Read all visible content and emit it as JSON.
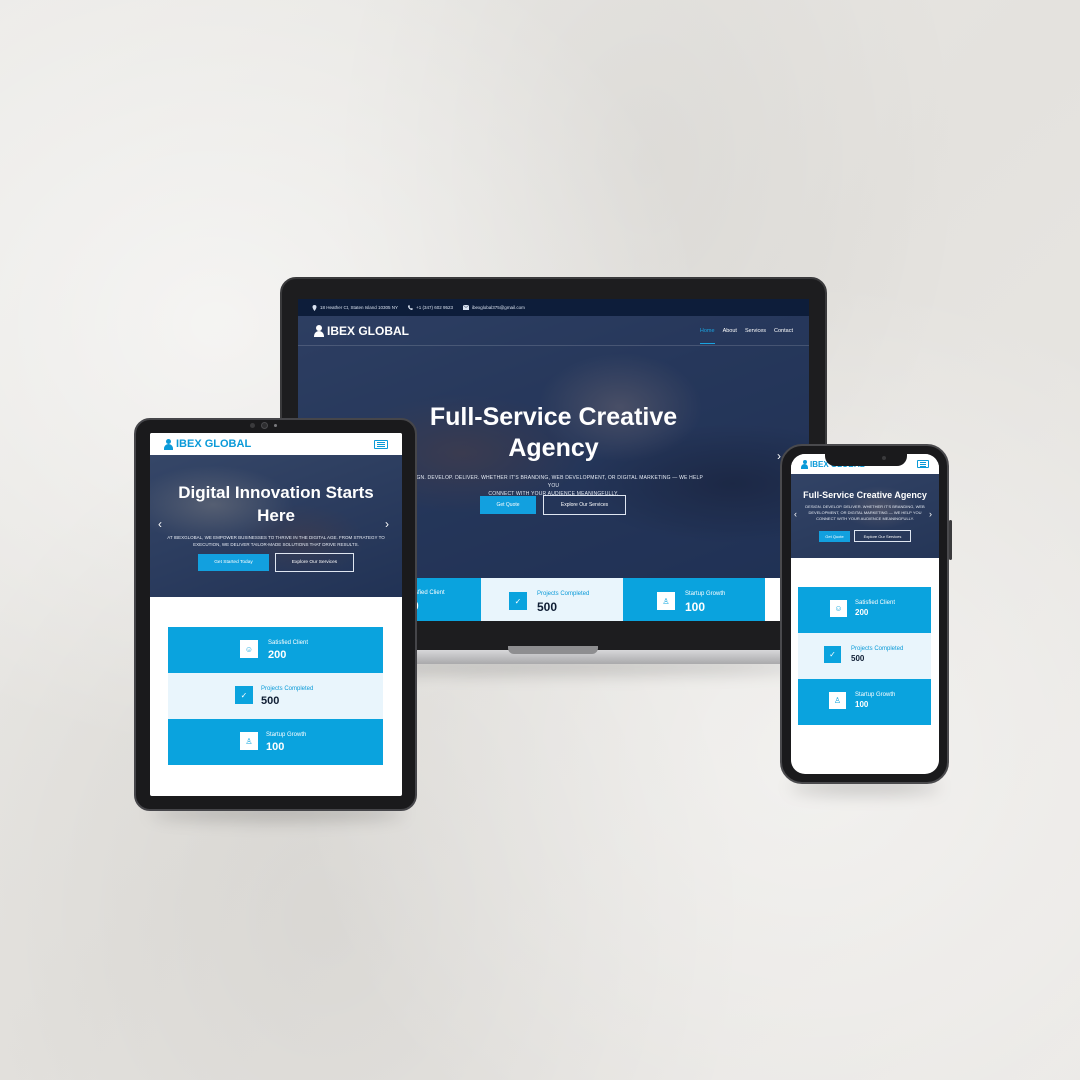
{
  "brand": {
    "name": "IBEX GLOBAL"
  },
  "desktop": {
    "topbar": {
      "address": "18 Heather Ct, Staten Island 10305 NY",
      "phone": "+1 (347) 602 9523",
      "email": "ibexglobal375@gmail.com"
    },
    "nav": {
      "items": [
        "Home",
        "About",
        "Services",
        "Contact"
      ],
      "active": "Home"
    },
    "hero": {
      "title_line1": "Full-Service Creative",
      "title_line2": "Agency",
      "subtitle_line1": "DESIGN. DEVELOP. DELIVER. WHETHER IT'S BRANDING, WEB DEVELOPMENT, OR DIGITAL MARKETING — WE HELP YOU",
      "subtitle_line2": "CONNECT WITH YOUR AUDIENCE MEANINGFULLY.",
      "primary_button": "Get Quote",
      "secondary_button": "Explore Our Services"
    },
    "stats": [
      {
        "label": "tisfied Client",
        "value": "0"
      },
      {
        "label": "Projects Completed",
        "value": "500"
      },
      {
        "label": "Startup Growth",
        "value": "100"
      }
    ]
  },
  "tablet": {
    "hero": {
      "title_line1": "Digital Innovation Starts",
      "title_line2": "Here",
      "subtitle_line1": "AT IBEXGLOBAL, WE EMPOWER BUSINESSES TO THRIVE IN THE DIGITAL AGE. FROM STRATEGY TO",
      "subtitle_line2": "EXECUTION, WE DELIVER TAILOR-MADE SOLUTIONS THAT DRIVE RESULTS.",
      "primary_button": "Get Started Today",
      "secondary_button": "Explore Our Services"
    },
    "stats": [
      {
        "label": "Satisfied Client",
        "value": "200"
      },
      {
        "label": "Projects Completed",
        "value": "500"
      },
      {
        "label": "Startup Growth",
        "value": "100"
      }
    ]
  },
  "phone": {
    "hero": {
      "title": "Full-Service Creative Agency",
      "subtitle_line1": "DESIGN. DEVELOP. DELIVER. WHETHER IT'S BRANDING, WEB",
      "subtitle_line2": "DEVELOPMENT, OR DIGITAL MARKETING — WE HELP YOU",
      "subtitle_line3": "CONNECT WITH YOUR AUDIENCE MEANINGFULLY.",
      "primary_button": "Get Quote",
      "secondary_button": "Explore Our Services"
    },
    "stats": [
      {
        "label": "Satisfied Client",
        "value": "200"
      },
      {
        "label": "Projects Completed",
        "value": "500"
      },
      {
        "label": "Startup Growth",
        "value": "100"
      }
    ]
  },
  "colors": {
    "accent": "#0aa3de",
    "navy": "#0d1d3a",
    "light": "#e9f5fc"
  },
  "icons": {
    "location": "map-pin-icon",
    "phone": "phone-icon",
    "email": "envelope-icon",
    "satisfied": "users-icon",
    "projects": "check-icon",
    "growth": "award-icon"
  }
}
